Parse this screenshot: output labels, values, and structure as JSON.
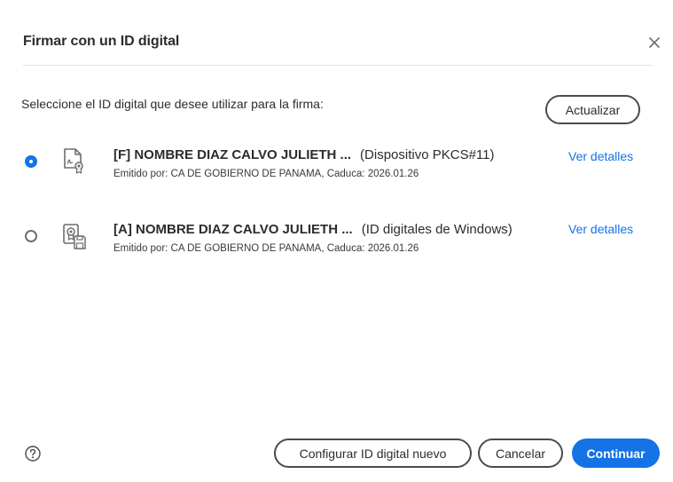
{
  "dialog": {
    "title": "Firmar con un ID digital",
    "prompt": "Seleccione el ID digital que desee utilizar para la firma:",
    "refresh_label": "Actualizar"
  },
  "ids": [
    {
      "name": "[F] NOMBRE DIAZ CALVO JULIETH ...",
      "type": "(Dispositivo PKCS#11)",
      "details": "Emitido por: CA DE GOBIERNO DE PANAMA, Caduca: 2026.01.26",
      "link": "Ver detalles",
      "selected": true,
      "icon": "certificate-document-icon"
    },
    {
      "name": "[A] NOMBRE DIAZ CALVO JULIETH ...",
      "type": "(ID digitales de Windows)",
      "details": "Emitido por: CA DE GOBIERNO DE PANAMA, Caduca: 2026.01.26",
      "link": "Ver detalles",
      "selected": false,
      "icon": "certificate-store-icon"
    }
  ],
  "footer": {
    "configure_label": "Configurar ID digital nuevo",
    "cancel_label": "Cancelar",
    "continue_label": "Continuar"
  },
  "colors": {
    "accent": "#1473e6",
    "text": "#2c2c2c"
  }
}
